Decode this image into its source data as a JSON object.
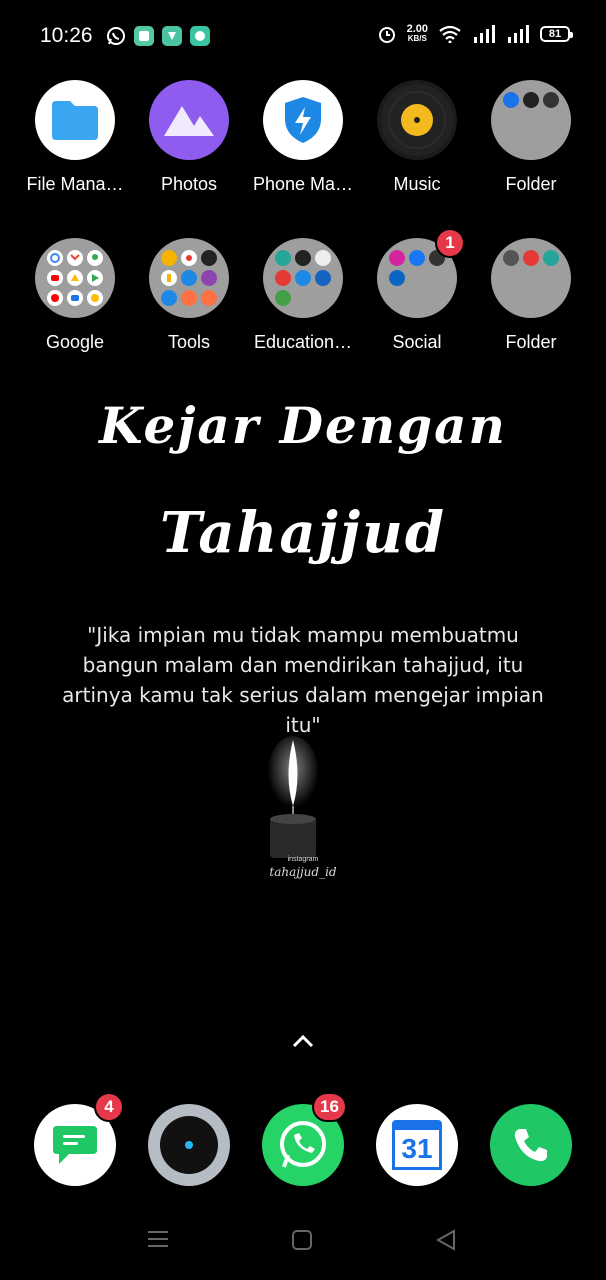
{
  "status_bar": {
    "time": "10:26",
    "speed_value": "2.00",
    "speed_unit": "KB/S",
    "battery": "81"
  },
  "apps_row1": [
    {
      "label": "File Mana…"
    },
    {
      "label": "Photos"
    },
    {
      "label": "Phone Ma…"
    },
    {
      "label": "Music"
    },
    {
      "label": "Folder"
    }
  ],
  "apps_row2": [
    {
      "label": "Google"
    },
    {
      "label": "Tools"
    },
    {
      "label": "Education…"
    },
    {
      "label": "Social",
      "badge": "1"
    },
    {
      "label": "Folder"
    }
  ],
  "wallpaper": {
    "title_line1": "Kejar Dengan",
    "title_line2": "Tahajjud",
    "quote": "\"Jika impian mu tidak mampu membuatmu bangun malam dan mendirikan tahajjud, itu artinya kamu tak serius dalam mengejar impian itu\"",
    "watermark_small": "instagram",
    "watermark_handle": "tahajjud_id"
  },
  "dock": {
    "messages_badge": "4",
    "whatsapp_badge": "16",
    "calendar_day": "31"
  },
  "colors": {
    "background": "#000000",
    "badge": "#e53949",
    "whatsapp": "#25d366",
    "phone": "#1fc765",
    "photos": "#8f5cf0",
    "file_manager": "#3aa5f0"
  }
}
